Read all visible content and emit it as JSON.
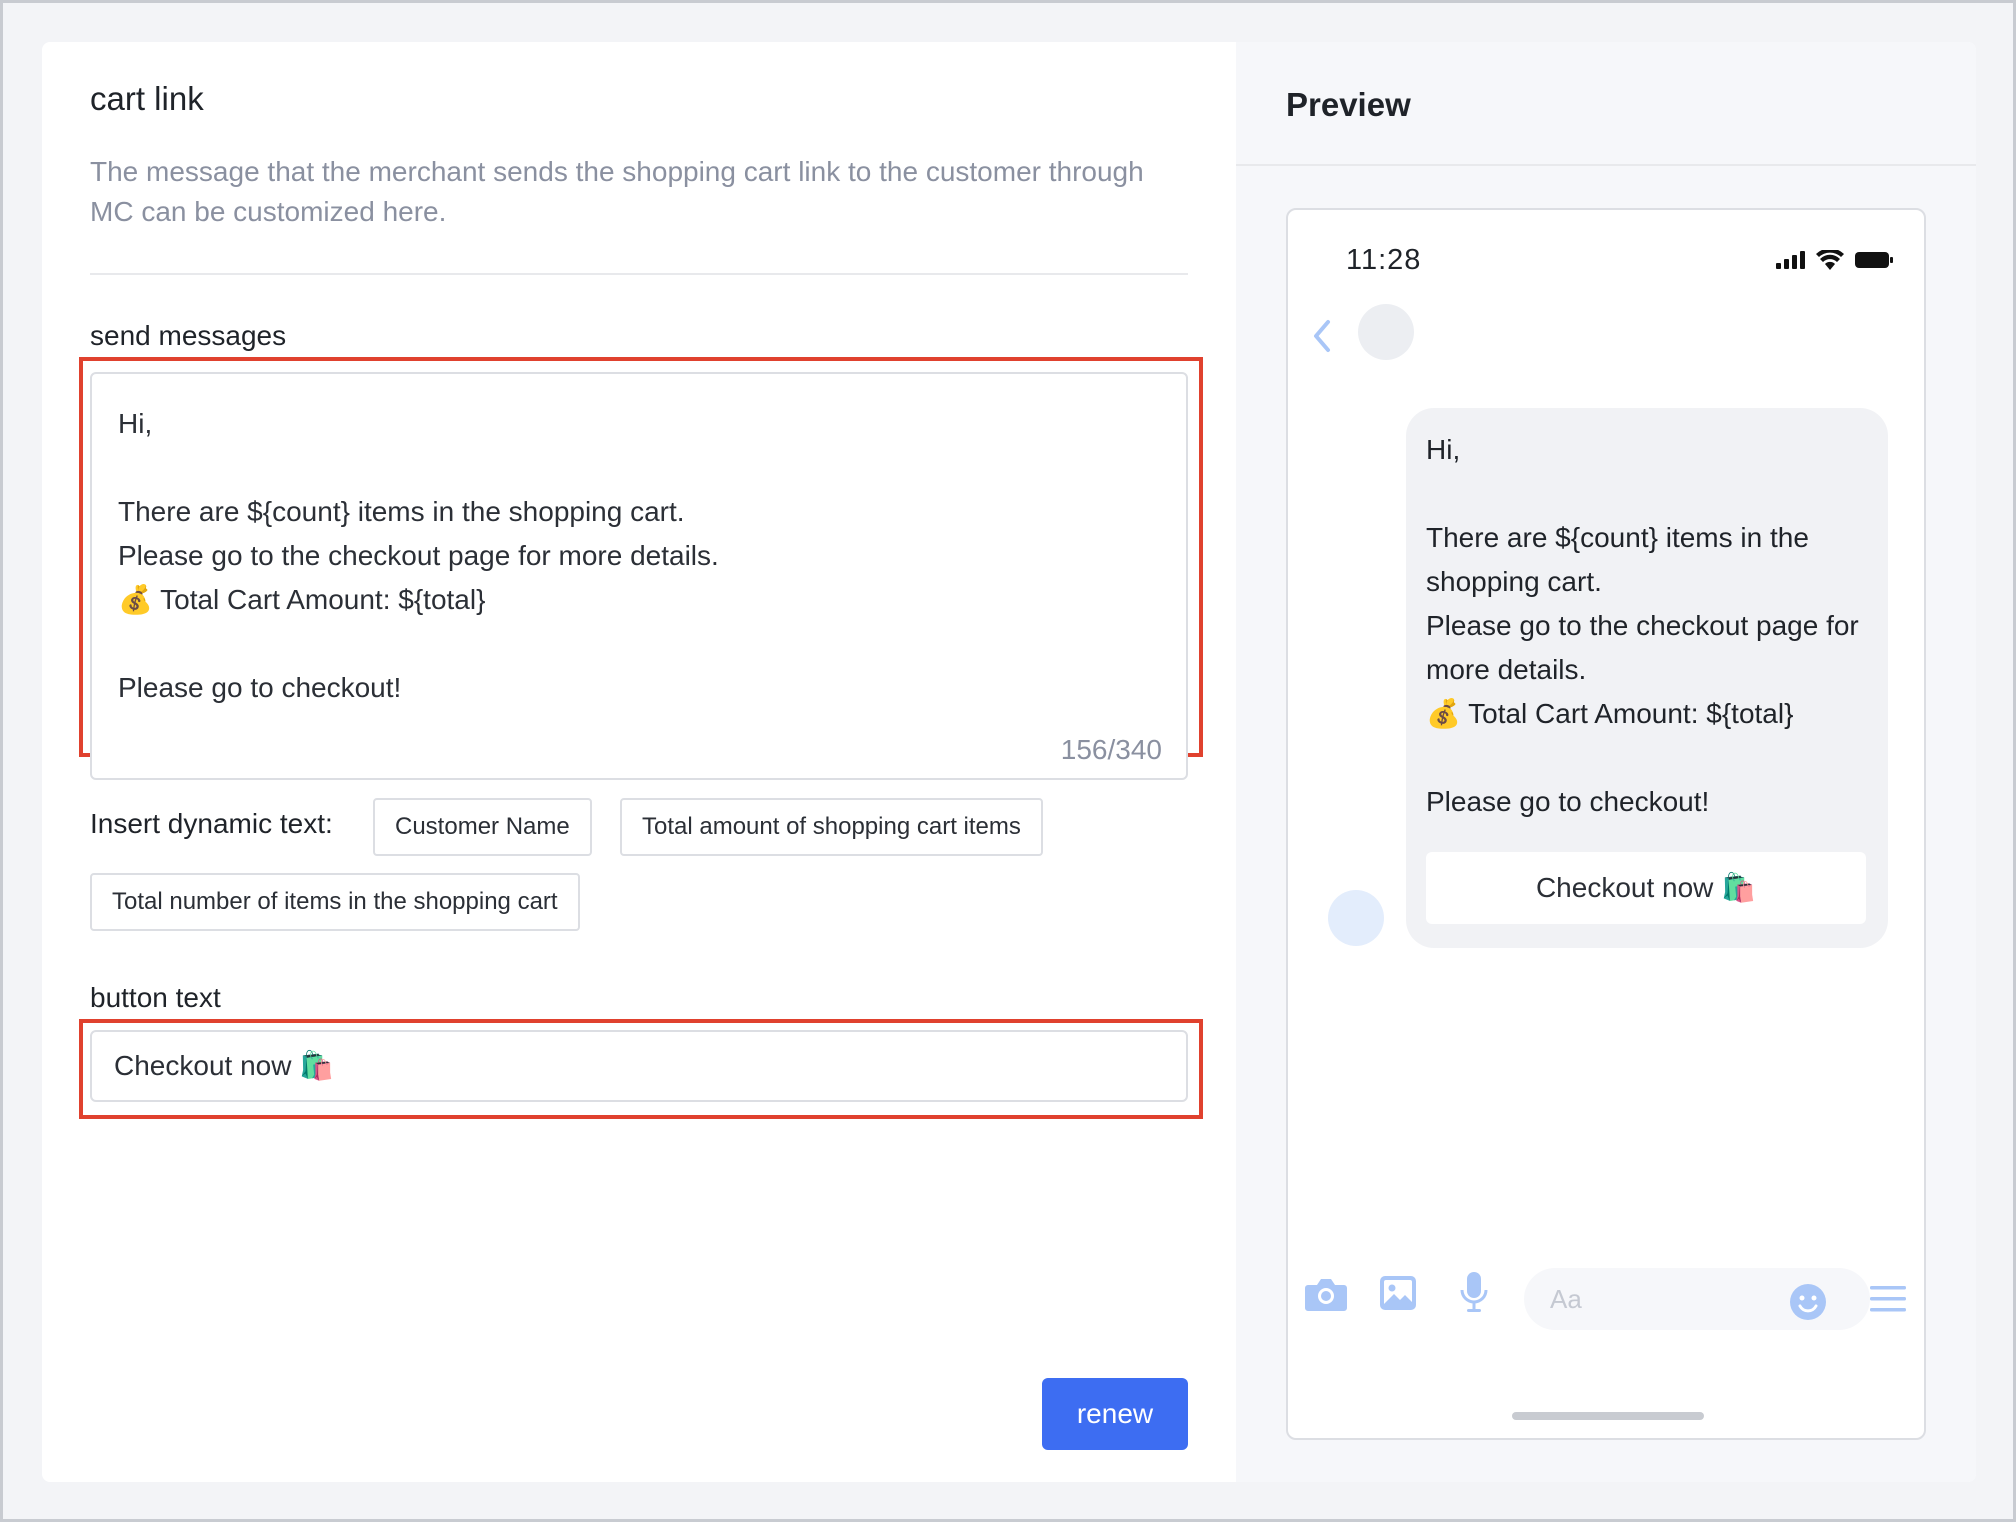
{
  "editor": {
    "title": "cart link",
    "description": "The message that the merchant sends the shopping cart link to the customer through MC can be customized here.",
    "send_label": "send messages",
    "message_lines": [
      "Hi,",
      "",
      "There are ${count} items in the shopping cart.",
      "Please go to the checkout page for more details.",
      "💰 Total Cart Amount: ${total}",
      "",
      "Please go to checkout!"
    ],
    "char_counter": "156/340",
    "dynamic_label": "Insert dynamic text:",
    "dynamic_chips": [
      "Customer Name",
      "Total amount of shopping cart items",
      "Total number of items in the shopping cart"
    ],
    "button_text_label": "button text",
    "button_text_value": "Checkout now 🛍️",
    "renew_label": "renew"
  },
  "preview": {
    "title": "Preview",
    "time": "11:28",
    "bubble_lines": [
      "Hi,",
      "",
      "There are ${count} items in the shopping cart.",
      "Please go to the checkout page for more details.",
      "💰 Total Cart Amount: ${total}",
      "",
      "Please go to checkout!"
    ],
    "bubble_button": "Checkout now 🛍️",
    "input_placeholder": "Aa",
    "icons": [
      "back-icon",
      "camera-icon",
      "image-icon",
      "mic-icon",
      "smile-icon",
      "menu-icon",
      "signal-icon",
      "wifi-icon",
      "battery-icon"
    ]
  },
  "colors": {
    "accent": "#3d6df2",
    "highlight": "#e0412e",
    "icon_blue": "#a9c6f7"
  }
}
